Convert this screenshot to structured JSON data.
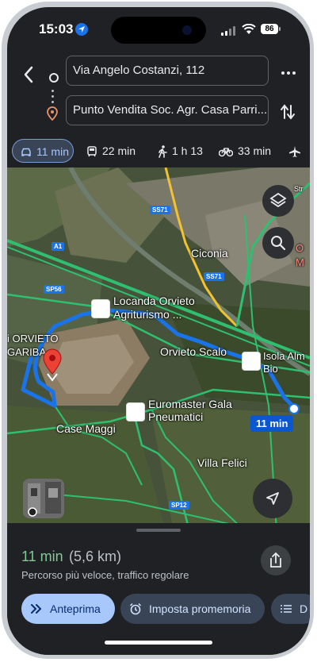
{
  "status_bar": {
    "time": "15:03",
    "battery": "86"
  },
  "directions": {
    "origin": "Via Angelo Costanzi, 112",
    "destination": "Punto Vendita Soc. Agr. Casa Parri..."
  },
  "modes": [
    {
      "icon": "car-icon",
      "label": "11 min",
      "active": true
    },
    {
      "icon": "train-icon",
      "label": "22 min"
    },
    {
      "icon": "walk-icon",
      "label": "1 h 13"
    },
    {
      "icon": "bike-icon",
      "label": "33 min"
    },
    {
      "icon": "plane-icon",
      "label": ""
    }
  ],
  "map": {
    "labels": {
      "ciconia": "Ciconia",
      "locanda": "Locanda Orvieto",
      "locanda2": "Agriturismo ...",
      "orvieto_scalo": "Orvieto Scalo",
      "isola": "Isola Alm",
      "isola2": "Bio",
      "orvieto": "i ORVIETO",
      "gariba": "GARIBA",
      "euromaster": "Euromaster Gala",
      "euromaster2": "Pneumatici",
      "case_maggi": "Case Maggi",
      "villa_felici": "Villa Felici",
      "edge_o": "O",
      "edge_m": "M",
      "edge_street": "Str"
    },
    "roads": {
      "ss71a": "SS71",
      "ss71b": "SS71",
      "a1": "A1",
      "sp56": "SP56",
      "sp12": "SP12"
    },
    "route_duration": "11 min"
  },
  "summary": {
    "eta": "11 min",
    "distance": "(5,6 km)",
    "description": "Percorso più veloce, traffico regolare"
  },
  "actions": {
    "preview": "Anteprima",
    "reminder": "Imposta promemoria",
    "steps": "D"
  },
  "colors": {
    "background": "#1f2124",
    "accent_blue": "#a8c7fa",
    "eta_green": "#81c995",
    "route_blue": "#1a73e8"
  }
}
